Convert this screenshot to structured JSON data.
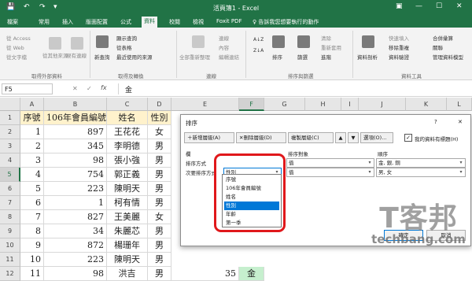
{
  "window": {
    "title": "活頁簿1 - Excel",
    "qa_save": "💾",
    "qa_undo": "↶",
    "qa_redo": "↷",
    "qa_more": "▾",
    "win_box": "▣",
    "win_min": "—",
    "win_max": "☐",
    "win_close": "✕"
  },
  "tabs": [
    "檔案",
    "常用",
    "插入",
    "版面配置",
    "公式",
    "資料",
    "校閱",
    "檢視",
    "Foxit PDF",
    "♀ 告訴我您想要執行的動作"
  ],
  "ribbon": {
    "ext": {
      "access": "從 Access",
      "web": "從 Web",
      "text": "從文字檔",
      "other": "從其他來源",
      "existing": "現有連線"
    },
    "get_new": {
      "new_query": "新查詢",
      "show": "顯示查詢",
      "table": "從表格",
      "recent": "最近使用的來源"
    },
    "conn": {
      "refresh": "全部重新整理",
      "connections": "連線",
      "properties": "內容",
      "edit_links": "編輯連結"
    },
    "sort": {
      "sort": "排序",
      "filter": "篩選",
      "clear": "清除",
      "reapply": "重新套用",
      "advanced": "進階"
    },
    "tools": {
      "text_to_cols": "資料剖析",
      "quick": "快速填入",
      "remove_dup": "移除重複",
      "validate": "資料驗證"
    },
    "outline": {
      "group": "組成群組",
      "ungroup": "取消群組",
      "subtotal": "小計",
      "consolidate": "合併彙算",
      "relationships": "關聯",
      "model": "管理資料模型",
      "whatif": "模擬分析",
      "forecast": "預測工作表"
    },
    "groups": [
      "取得外部資料",
      "取得及轉換",
      "連線",
      "排序與篩選",
      "資料工具"
    ]
  },
  "formula_bar": {
    "name_box": "F5",
    "fx": "fx",
    "cancel": "✕",
    "enter": "✓",
    "value": "金"
  },
  "grid": {
    "columns": [
      "A",
      "B",
      "C",
      "D",
      "E",
      "F",
      "G",
      "H",
      "I",
      "J",
      "K",
      "L"
    ],
    "rows": [
      "1",
      "2",
      "3",
      "4",
      "5",
      "6",
      "7",
      "8",
      "9",
      "10",
      "11",
      "12"
    ],
    "header": [
      "序號",
      "106年會員編號",
      "姓名",
      "性別"
    ],
    "data": [
      [
        "1",
        "897",
        "王花花",
        "女"
      ],
      [
        "2",
        "345",
        "李明德",
        "男"
      ],
      [
        "3",
        "98",
        "張小強",
        "男"
      ],
      [
        "4",
        "754",
        "郭正義",
        "男"
      ],
      [
        "5",
        "223",
        "陳明天",
        "男"
      ],
      [
        "6",
        "1",
        "柯有情",
        "男"
      ],
      [
        "7",
        "827",
        "王美麗",
        "女"
      ],
      [
        "8",
        "34",
        "朱麗芯",
        "男"
      ],
      [
        "9",
        "872",
        "楊珊年",
        "男"
      ],
      [
        "10",
        "223",
        "陳明天",
        "男"
      ],
      [
        "11",
        "98",
        "洪吉",
        "男"
      ]
    ],
    "e12": "35",
    "f12": "金"
  },
  "dialog": {
    "title": "排序",
    "help": "?",
    "close": "✕",
    "add": "新增層級(A)",
    "delete": "刪除層級(D)",
    "copy": "複製層級(C)",
    "up": "▲",
    "down": "▼",
    "options": "選項(O)...",
    "checkbox_label": "我的資料有標題(H)",
    "col_header": "欄",
    "basis_header": "排序對象",
    "order_header": "順序",
    "row1_label": "排序方式",
    "row1_basis": "值",
    "row1_order": "金, 銀, 銅",
    "row2_label": "次要排序方式",
    "row2_field": "性別",
    "row2_basis": "值",
    "row2_order": "男, 女",
    "ok": "確定",
    "cancel": "取消"
  },
  "dropdown": [
    "序號",
    "106年會員編號",
    "姓名",
    "性別",
    "年齡",
    "第一季"
  ],
  "watermark": {
    "big": "T客邦",
    "url": "techbang.com"
  }
}
